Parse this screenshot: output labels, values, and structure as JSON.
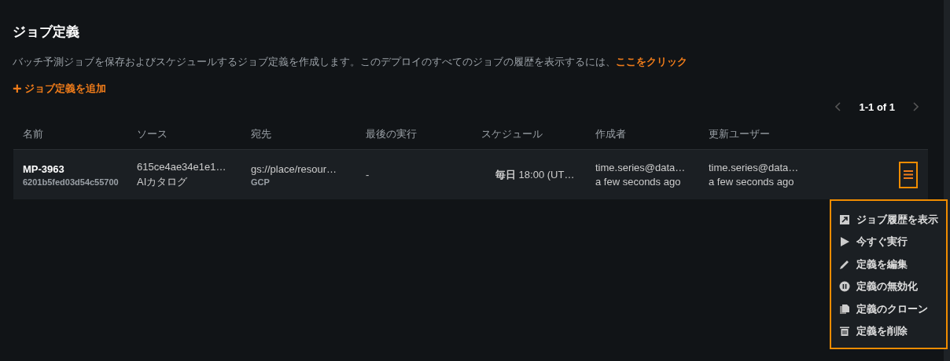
{
  "title": "ジョブ定義",
  "description": {
    "text": "バッチ予測ジョブを保存およびスケジュールするジョブ定義を作成します。このデプロイのすべてのジョブの履歴を表示するには、",
    "link": "ここをクリック"
  },
  "add_button": {
    "icon": "+",
    "label": "ジョブ定義を追加"
  },
  "pagination": {
    "label": "1-1 of 1"
  },
  "table": {
    "columns": [
      "名前",
      "ソース",
      "宛先",
      "最後の実行",
      "スケジュール",
      "作成者",
      "更新ユーザー"
    ],
    "rows": [
      {
        "name": "MP-3963",
        "id": "6201b5fed03d54c55700",
        "source": "615ce4ae34e1e1…",
        "source_sub": "AIカタログ",
        "destination": "gs://place/resour…",
        "destination_sub": "GCP",
        "last_run": "-",
        "schedule": "**毎日** 18:00 (UT…",
        "created_by": "time.series@data…",
        "created_time": "a few seconds ago",
        "updated_by": "time.series@data…",
        "updated_time": "a few seconds ago",
        "menu_open": true
      }
    ]
  },
  "menu": [
    {
      "kind": "history",
      "label": "ジョブ履歴を表示"
    },
    {
      "kind": "run",
      "label": "今すぐ実行"
    },
    {
      "kind": "edit",
      "label": "定義を編集"
    },
    {
      "kind": "disable",
      "label": "定義の無効化"
    },
    {
      "kind": "clone",
      "label": "定義のクローン"
    },
    {
      "kind": "delete",
      "label": "定義を削除"
    }
  ]
}
